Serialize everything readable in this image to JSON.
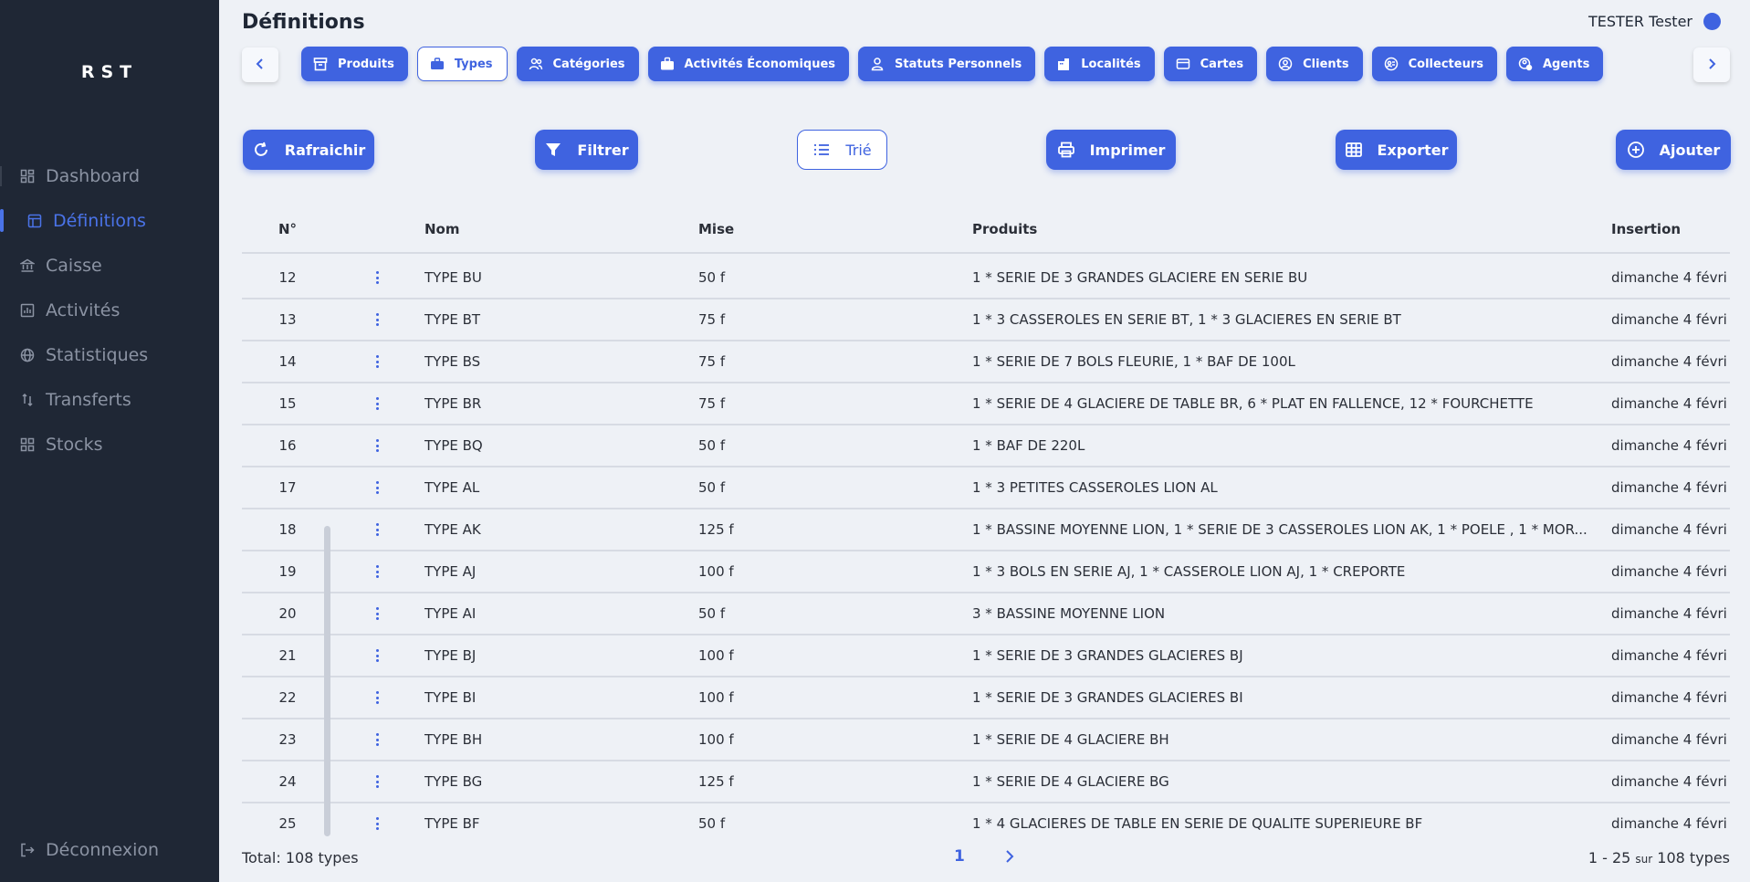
{
  "app": {
    "logo": "RST"
  },
  "sidebar": {
    "items": [
      {
        "label": "Dashboard",
        "icon": "dashboard-icon"
      },
      {
        "label": "Définitions",
        "icon": "layout-icon"
      },
      {
        "label": "Caisse",
        "icon": "bank-icon"
      },
      {
        "label": "Activités",
        "icon": "chart-icon"
      },
      {
        "label": "Statistiques",
        "icon": "globe-icon"
      },
      {
        "label": "Transferts",
        "icon": "transfer-icon"
      },
      {
        "label": "Stocks",
        "icon": "grid-icon"
      }
    ],
    "logout": "Déconnexion"
  },
  "header": {
    "title": "Définitions",
    "user": "TESTER Tester"
  },
  "tabs": [
    {
      "label": "Produits",
      "icon": "archive-icon"
    },
    {
      "label": "Types",
      "icon": "briefcase-icon"
    },
    {
      "label": "Catégories",
      "icon": "users-icon"
    },
    {
      "label": "Activités Économiques",
      "icon": "bag-icon"
    },
    {
      "label": "Statuts Personnels",
      "icon": "person-icon"
    },
    {
      "label": "Localités",
      "icon": "building-icon"
    },
    {
      "label": "Cartes",
      "icon": "card-icon"
    },
    {
      "label": "Clients",
      "icon": "user-circle-icon"
    },
    {
      "label": "Collecteurs",
      "icon": "collector-icon"
    },
    {
      "label": "Agents",
      "icon": "agent-icon"
    }
  ],
  "toolbar": {
    "refresh": "Rafraichir",
    "filter": "Filtrer",
    "sort": "Trié",
    "print": "Imprimer",
    "export": "Exporter",
    "add": "Ajouter"
  },
  "table": {
    "headers": {
      "num": "N°",
      "nom": "Nom",
      "mise": "Mise",
      "produits": "Produits",
      "insertion": "Insertion"
    },
    "rows": [
      {
        "num": "12",
        "nom": "TYPE BU",
        "mise": "50 f",
        "produits": "1 * SERIE DE 3 GRANDES GLACIERE EN SERIE BU",
        "insertion": "dimanche 4 févri"
      },
      {
        "num": "13",
        "nom": "TYPE BT",
        "mise": "75 f",
        "produits": "1 * 3 CASSEROLES EN SERIE BT, 1 * 3 GLACIERES EN SERIE BT",
        "insertion": "dimanche 4 févri"
      },
      {
        "num": "14",
        "nom": "TYPE BS",
        "mise": "75 f",
        "produits": "1 * SERIE DE 7 BOLS FLEURIE, 1 * BAF DE 100L",
        "insertion": "dimanche 4 févri"
      },
      {
        "num": "15",
        "nom": "TYPE BR",
        "mise": "75 f",
        "produits": "1 * SERIE DE 4 GLACIERE DE TABLE BR, 6 * PLAT EN FALLENCE, 12 * FOURCHETTE",
        "insertion": "dimanche 4 févri"
      },
      {
        "num": "16",
        "nom": "TYPE BQ",
        "mise": "50 f",
        "produits": "1 * BAF DE 220L",
        "insertion": "dimanche 4 févri"
      },
      {
        "num": "17",
        "nom": "TYPE AL",
        "mise": "50 f",
        "produits": "1 * 3 PETITES CASSEROLES LION AL",
        "insertion": "dimanche 4 févri"
      },
      {
        "num": "18",
        "nom": "TYPE AK",
        "mise": "125 f",
        "produits": "1 * BASSINE MOYENNE LION, 1 * SERIE DE 3 CASSEROLES LION AK, 1 * POELE , 1 * MOR...",
        "insertion": "dimanche 4 févri"
      },
      {
        "num": "19",
        "nom": "TYPE AJ",
        "mise": "100 f",
        "produits": "1 * 3 BOLS EN SERIE AJ, 1 * CASSEROLE LION AJ, 1 * CREPORTE",
        "insertion": "dimanche 4 févri"
      },
      {
        "num": "20",
        "nom": "TYPE AI",
        "mise": "50 f",
        "produits": "3 * BASSINE MOYENNE LION",
        "insertion": "dimanche 4 févri"
      },
      {
        "num": "21",
        "nom": "TYPE BJ",
        "mise": "100 f",
        "produits": "1 * SERIE DE 3 GRANDES GLACIERES BJ",
        "insertion": "dimanche 4 févri"
      },
      {
        "num": "22",
        "nom": "TYPE BI",
        "mise": "100 f",
        "produits": "1 * SERIE DE 3 GRANDES GLACIERES BI",
        "insertion": "dimanche 4 févri"
      },
      {
        "num": "23",
        "nom": "TYPE BH",
        "mise": "100 f",
        "produits": "1 * SERIE DE 4 GLACIERE BH",
        "insertion": "dimanche 4 févri"
      },
      {
        "num": "24",
        "nom": "TYPE BG",
        "mise": "125 f",
        "produits": "1 * SERIE DE 4 GLACIERE BG",
        "insertion": "dimanche 4 févri"
      },
      {
        "num": "25",
        "nom": "TYPE BF",
        "mise": "50 f",
        "produits": "1 * 4 GLACIERES DE TABLE EN SERIE DE QUALITE SUPERIEURE BF",
        "insertion": "dimanche 4 févri"
      }
    ]
  },
  "footer": {
    "total": "Total: 108 types",
    "page": "1",
    "range": "1 - 25",
    "sur": "sur",
    "range_total": "108 types"
  },
  "colors": {
    "accent": "#3f63e0",
    "sidebar": "#1f2735",
    "background": "#eef1f6"
  }
}
